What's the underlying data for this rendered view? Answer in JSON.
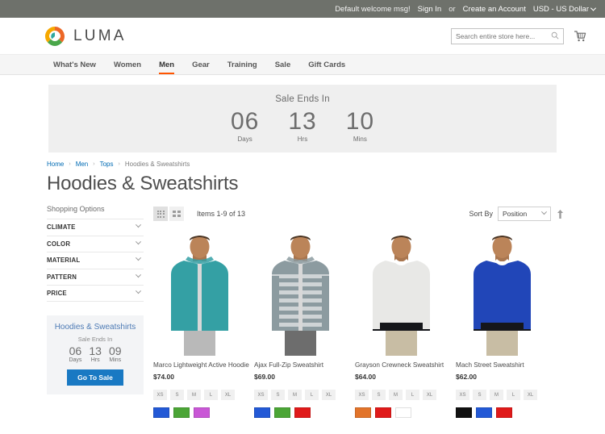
{
  "top_panel": {
    "welcome": "Default welcome msg!",
    "sign_in": "Sign In",
    "or": "or",
    "create_account": "Create an Account",
    "currency": "USD - US Dollar"
  },
  "header": {
    "logo_text": "LUMA",
    "search_placeholder": "Search entire store here...",
    "search_value": "",
    "search_icon": "search-icon",
    "cart_icon": "shopping-cart-icon"
  },
  "nav": {
    "items": [
      {
        "label": "What's New",
        "active": false
      },
      {
        "label": "Women",
        "active": false
      },
      {
        "label": "Men",
        "active": true
      },
      {
        "label": "Gear",
        "active": false
      },
      {
        "label": "Training",
        "active": false
      },
      {
        "label": "Sale",
        "active": false
      },
      {
        "label": "Gift Cards",
        "active": false
      }
    ]
  },
  "banner": {
    "title": "Sale Ends In",
    "clock": [
      {
        "value": "06",
        "label": "Days"
      },
      {
        "value": "13",
        "label": "Hrs"
      },
      {
        "value": "10",
        "label": "Mins"
      }
    ]
  },
  "breadcrumb": {
    "items": [
      "Home",
      "Men",
      "Tops"
    ],
    "current": "Hoodies & Sweatshirts",
    "separator": "›"
  },
  "page_title": "Hoodies & Sweatshirts",
  "sidebar": {
    "title": "Shopping Options",
    "filters": [
      "CLIMATE",
      "COLOR",
      "MATERIAL",
      "PATTERN",
      "PRICE"
    ],
    "promo": {
      "title": "Hoodies & Sweatshirts",
      "subtitle": "Sale Ends In",
      "clock": [
        {
          "value": "06",
          "label": "Days"
        },
        {
          "value": "13",
          "label": "Hrs"
        },
        {
          "value": "09",
          "label": "Mins"
        }
      ],
      "button": "Go To Sale"
    }
  },
  "toolbar": {
    "grid_view_icon": "grid-view-icon",
    "list_view_icon": "list-view-icon",
    "items_count": "Items 1-9 of 13",
    "sort_label": "Sort By",
    "sort_value": "Position",
    "sort_direction_icon": "sort-ascending-icon"
  },
  "products": [
    {
      "name": "Marco Lightweight Active Hoodie",
      "price": "$74.00",
      "sizes": [
        "XS",
        "S",
        "M",
        "L",
        "XL"
      ],
      "colors": [
        "#2359d6",
        "#4ba536",
        "#c957d6"
      ],
      "image": {
        "garment": "#34a0a4",
        "pants": "#b9b9b9",
        "type": "zip-hoodie"
      }
    },
    {
      "name": "Ajax Full-Zip Sweatshirt",
      "price": "$69.00",
      "sizes": [
        "XS",
        "S",
        "M",
        "L",
        "XL"
      ],
      "colors": [
        "#2359d6",
        "#4ba536",
        "#e01a1a"
      ],
      "image": {
        "garment": "#8c9ba0",
        "pants": "#6d6d6d",
        "type": "striped-zip-hoodie"
      }
    },
    {
      "name": "Grayson Crewneck Sweatshirt",
      "price": "$64.00",
      "sizes": [
        "XS",
        "S",
        "M",
        "L",
        "XL"
      ],
      "colors": [
        "#e2742a",
        "#e01a1a",
        "#ffffff"
      ],
      "image": {
        "garment": "#e8e8e6",
        "pants": "#c8bda4",
        "type": "crewneck"
      }
    },
    {
      "name": "Mach Street Sweatshirt",
      "price": "$62.00",
      "sizes": [
        "XS",
        "S",
        "M",
        "L",
        "XL"
      ],
      "colors": [
        "#111111",
        "#2359d6",
        "#e01a1a"
      ],
      "image": {
        "garment": "#2146b8",
        "pants": "#c8bda4",
        "type": "crewneck"
      }
    }
  ],
  "colors": {
    "accent": "#ff5501",
    "link": "#006bb4",
    "button": "#1979c3",
    "top_bar": "#6e716b"
  }
}
